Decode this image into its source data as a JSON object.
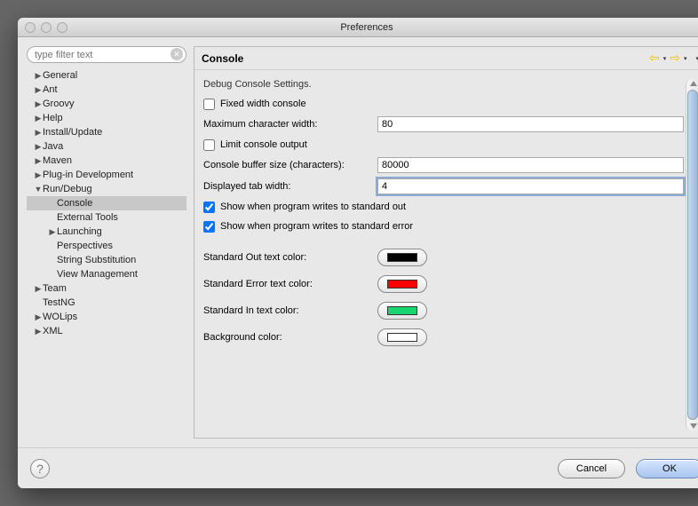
{
  "window": {
    "title": "Preferences"
  },
  "search": {
    "placeholder": "type filter text"
  },
  "tree": [
    {
      "label": "General",
      "depth": 0,
      "expandable": true,
      "expanded": false
    },
    {
      "label": "Ant",
      "depth": 0,
      "expandable": true,
      "expanded": false
    },
    {
      "label": "Groovy",
      "depth": 0,
      "expandable": true,
      "expanded": false
    },
    {
      "label": "Help",
      "depth": 0,
      "expandable": true,
      "expanded": false
    },
    {
      "label": "Install/Update",
      "depth": 0,
      "expandable": true,
      "expanded": false
    },
    {
      "label": "Java",
      "depth": 0,
      "expandable": true,
      "expanded": false
    },
    {
      "label": "Maven",
      "depth": 0,
      "expandable": true,
      "expanded": false
    },
    {
      "label": "Plug-in Development",
      "depth": 0,
      "expandable": true,
      "expanded": false
    },
    {
      "label": "Run/Debug",
      "depth": 0,
      "expandable": true,
      "expanded": true
    },
    {
      "label": "Console",
      "depth": 1,
      "expandable": false,
      "selected": true
    },
    {
      "label": "External Tools",
      "depth": 1,
      "expandable": false
    },
    {
      "label": "Launching",
      "depth": 1,
      "expandable": true,
      "expanded": false
    },
    {
      "label": "Perspectives",
      "depth": 1,
      "expandable": false
    },
    {
      "label": "String Substitution",
      "depth": 1,
      "expandable": false
    },
    {
      "label": "View Management",
      "depth": 1,
      "expandable": false
    },
    {
      "label": "Team",
      "depth": 0,
      "expandable": true,
      "expanded": false
    },
    {
      "label": "TestNG",
      "depth": 0,
      "expandable": false
    },
    {
      "label": "WOLips",
      "depth": 0,
      "expandable": true,
      "expanded": false
    },
    {
      "label": "XML",
      "depth": 0,
      "expandable": true,
      "expanded": false
    }
  ],
  "page": {
    "title": "Console",
    "subtitle": "Debug Console Settings.",
    "fixed_width": {
      "label": "Fixed width console",
      "checked": false
    },
    "max_width": {
      "label": "Maximum character width:",
      "value": "80"
    },
    "limit_output": {
      "label": "Limit console output",
      "checked": false
    },
    "buffer_size": {
      "label": "Console buffer size (characters):",
      "value": "80000"
    },
    "tab_width": {
      "label": "Displayed tab width:",
      "value": "4"
    },
    "show_stdout": {
      "label": "Show when program writes to standard out",
      "checked": true
    },
    "show_stderr": {
      "label": "Show when program writes to standard error",
      "checked": true
    },
    "colors": {
      "stdout": {
        "label": "Standard Out text color:",
        "value": "#000000"
      },
      "stderr": {
        "label": "Standard Error text color:",
        "value": "#ff0000"
      },
      "stdin": {
        "label": "Standard In text color:",
        "value": "#18d66f"
      },
      "bg": {
        "label": "Background color:",
        "value": "#ffffff"
      }
    }
  },
  "footer": {
    "cancel": "Cancel",
    "ok": "OK"
  }
}
